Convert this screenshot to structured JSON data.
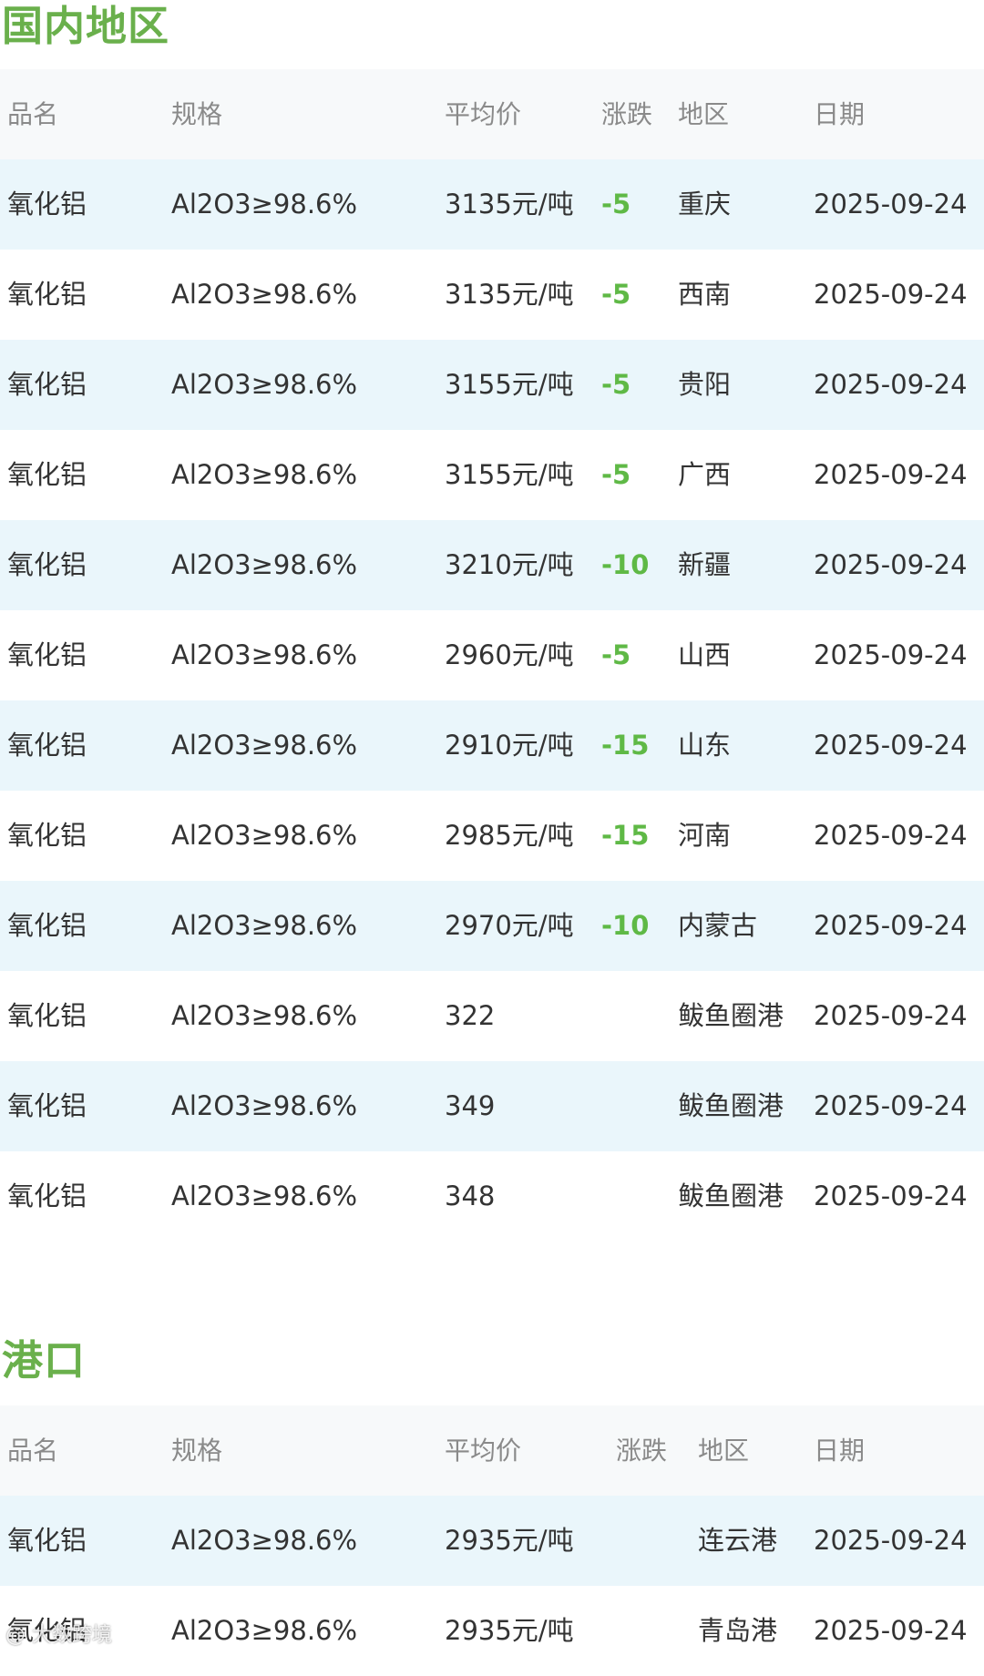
{
  "sections": [
    {
      "title": "国内地区",
      "headers": [
        "品名",
        "规格",
        "平均价",
        "涨跌",
        "地区",
        "日期"
      ],
      "rows": [
        {
          "name": "氧化铝",
          "spec": "Al2O3≥98.6%",
          "price": "3135元/吨",
          "change": "-5",
          "region": "重庆",
          "date": "2025-09-24"
        },
        {
          "name": "氧化铝",
          "spec": "Al2O3≥98.6%",
          "price": "3135元/吨",
          "change": "-5",
          "region": "西南",
          "date": "2025-09-24"
        },
        {
          "name": "氧化铝",
          "spec": "Al2O3≥98.6%",
          "price": "3155元/吨",
          "change": "-5",
          "region": "贵阳",
          "date": "2025-09-24"
        },
        {
          "name": "氧化铝",
          "spec": "Al2O3≥98.6%",
          "price": "3155元/吨",
          "change": "-5",
          "region": "广西",
          "date": "2025-09-24"
        },
        {
          "name": "氧化铝",
          "spec": "Al2O3≥98.6%",
          "price": "3210元/吨",
          "change": "-10",
          "region": "新疆",
          "date": "2025-09-24"
        },
        {
          "name": "氧化铝",
          "spec": "Al2O3≥98.6%",
          "price": "2960元/吨",
          "change": "-5",
          "region": "山西",
          "date": "2025-09-24"
        },
        {
          "name": "氧化铝",
          "spec": "Al2O3≥98.6%",
          "price": "2910元/吨",
          "change": "-15",
          "region": "山东",
          "date": "2025-09-24"
        },
        {
          "name": "氧化铝",
          "spec": "Al2O3≥98.6%",
          "price": "2985元/吨",
          "change": "-15",
          "region": "河南",
          "date": "2025-09-24"
        },
        {
          "name": "氧化铝",
          "spec": "Al2O3≥98.6%",
          "price": "2970元/吨",
          "change": "-10",
          "region": "内蒙古",
          "date": "2025-09-24"
        },
        {
          "name": "氧化铝",
          "spec": "Al2O3≥98.6%",
          "price": "322",
          "change": "",
          "region": "鲅鱼圈港",
          "date": "2025-09-24"
        },
        {
          "name": "氧化铝",
          "spec": "Al2O3≥98.6%",
          "price": "349",
          "change": "",
          "region": "鲅鱼圈港",
          "date": "2025-09-24"
        },
        {
          "name": "氧化铝",
          "spec": "Al2O3≥98.6%",
          "price": "348",
          "change": "",
          "region": "鲅鱼圈港",
          "date": "2025-09-24"
        }
      ]
    },
    {
      "title": "港口",
      "headers": [
        "品名",
        "规格",
        "平均价",
        "涨跌",
        "地区",
        "日期"
      ],
      "rows": [
        {
          "name": "氧化铝",
          "spec": "Al2O3≥98.6%",
          "price": "2935元/吨",
          "change": "",
          "region": "连云港",
          "date": "2025-09-24"
        },
        {
          "name": "氧化铝",
          "spec": "Al2O3≥98.6%",
          "price": "2935元/吨",
          "change": "",
          "region": "青岛港",
          "date": "2025-09-24"
        }
      ]
    }
  ],
  "colors": {
    "title_green": "#6ab04c",
    "change_green": "#5fb946",
    "row_alt": "#eaf6fb",
    "header_bg": "#f7f9fa"
  },
  "watermark": "@ 大数跨境"
}
